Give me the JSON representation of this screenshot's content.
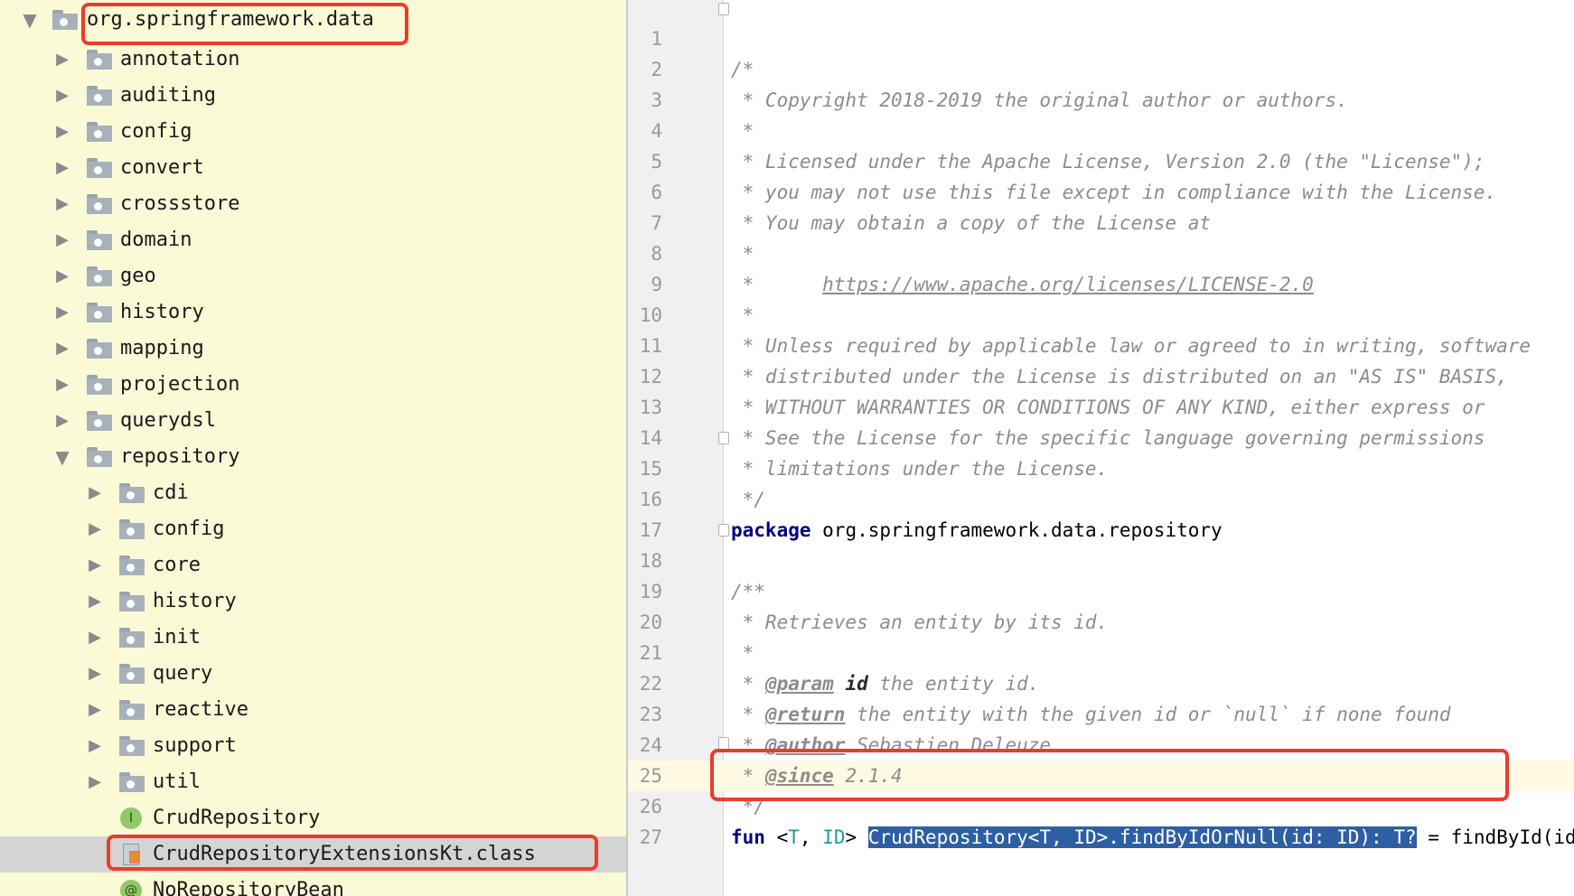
{
  "tree": {
    "root": "org.springframework.data",
    "items": [
      "annotation",
      "auditing",
      "config",
      "convert",
      "crossstore",
      "domain",
      "geo",
      "history",
      "mapping",
      "projection",
      "querydsl"
    ],
    "repository": "repository",
    "repo_children": [
      "cdi",
      "config",
      "core",
      "history",
      "init",
      "query",
      "reactive",
      "support",
      "util"
    ],
    "files": [
      {
        "badge": "I",
        "label": "CrudRepository"
      },
      {
        "badge": "",
        "label": "CrudRepositoryExtensionsKt.class"
      },
      {
        "badge": "@",
        "label": "NoRepositoryBean"
      }
    ]
  },
  "editor": {
    "line_numbers": [
      "1",
      "2",
      "3",
      "4",
      "5",
      "6",
      "7",
      "8",
      "9",
      "10",
      "11",
      "12",
      "13",
      "14",
      "15",
      "16",
      "17",
      "18",
      "19",
      "20",
      "21",
      "22",
      "23",
      "24",
      "25",
      "26",
      "27"
    ],
    "lines": {
      "l1": "/*",
      "l2": " * Copyright 2018-2019 the original author or authors.",
      "l3": " *",
      "l4": " * Licensed under the Apache License, Version 2.0 (the \"License\");",
      "l5": " * you may not use this file except in compliance with the License.",
      "l6": " * You may obtain a copy of the License at",
      "l7": " *",
      "l8_prefix": " *      ",
      "l8_link": "https://www.apache.org/licenses/LICENSE-2.0",
      "l9": " *",
      "l10": " * Unless required by applicable law or agreed to in writing, software",
      "l11": " * distributed under the License is distributed on an \"AS IS\" BASIS,",
      "l12": " * WITHOUT WARRANTIES OR CONDITIONS OF ANY KIND, either express or",
      "l13": " * See the License for the specific language governing permissions",
      "l14": " * limitations under the License.",
      "l15": " */",
      "l16_kw": "package",
      "l16_rest": " org.springframework.data.repository",
      "l17": "",
      "l18": "/**",
      "l19": " * Retrieves an entity by its id.",
      "l20": " *",
      "l21_pre": " * ",
      "l21_tag": "@param",
      "l21_name": "id",
      "l21_rest": " the entity id.",
      "l22_pre": " * ",
      "l22_tag": "@return",
      "l22_rest": " the entity with the given id or `null` if none found",
      "l23_pre": " * ",
      "l23_tag": "@author",
      "l23_rest": " Sebastien Deleuze",
      "l24_pre": " * ",
      "l24_tag": "@since",
      "l24_rest": " 2.1.4",
      "l25": " */",
      "l26_kw": "fun",
      "l26_lt": " <",
      "l26_T": "T",
      "l26_comma": ", ",
      "l26_ID": "ID",
      "l26_gt": "> ",
      "l26_sel": "CrudRepository<T, ID>.findByIdOrNull(id: ID): T?",
      "l26_rest": " = findById(id).orElse(null)",
      "l27": ""
    }
  },
  "colors": {
    "tree_bg": "#fafad7",
    "highlight_box": "#ee3b2a",
    "selection": "#2c5fa3",
    "keyword": "#000080",
    "comment": "#8c8c8c"
  }
}
